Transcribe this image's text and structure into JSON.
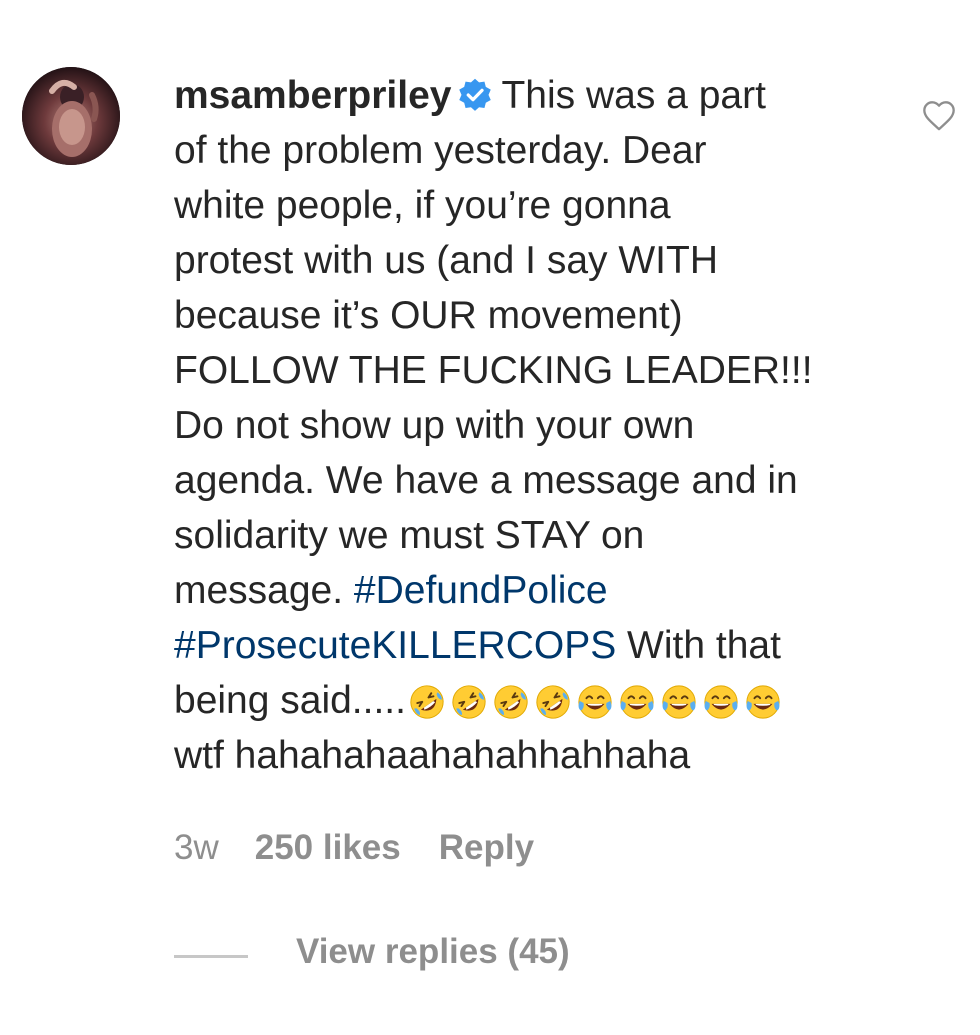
{
  "comment": {
    "username": "msamberpriley",
    "verified_icon": "verified-badge-icon",
    "avatar_icon": "profile-avatar",
    "like_icon": "heart-outline-icon",
    "text_lines": [
      "This was a part",
      "of the problem yesterday. Dear",
      "white people, if you’re gonna",
      "protest with us (and I say WITH",
      "because it’s OUR movement)",
      "FOLLOW THE FUCKING LEADER!!!",
      "Do not show up with your own",
      "agenda. We have a message and in",
      "solidarity we must STAY on",
      "message. "
    ],
    "hashtags": [
      "#DefundPolice",
      "#ProsecuteKILLERCOPS"
    ],
    "after_hashtags": " With that",
    "being_said": "being said.....",
    "emojis": [
      "rolling-on-floor-laughing",
      "rolling-on-floor-laughing",
      "rolling-on-floor-laughing",
      "rolling-on-floor-laughing",
      "face-with-tears-of-joy",
      "face-with-tears-of-joy",
      "face-with-tears-of-joy",
      "face-with-tears-of-joy",
      "face-with-tears-of-joy"
    ],
    "last_line": "wtf hahahahaahahahhahhaha",
    "timestamp": "3w",
    "likes": "250 likes",
    "reply_label": "Reply",
    "view_replies_label": "View replies (45)"
  },
  "colors": {
    "text": "#262626",
    "hashtag": "#00376b",
    "meta": "#8e8e8e",
    "verified": "#3897f0",
    "emoji_face": "#ffcc33",
    "tears": "#5aaef0"
  }
}
